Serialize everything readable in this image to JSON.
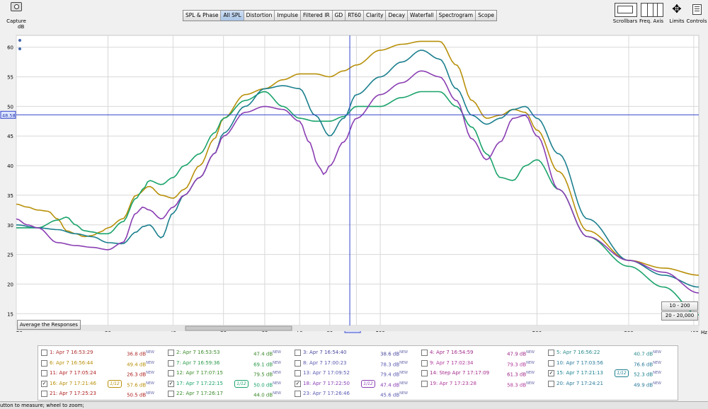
{
  "toolbar": {
    "capture_label": "Capture",
    "tabs": [
      "SPL & Phase",
      "All SPL",
      "Distortion",
      "Impulse",
      "Filtered IR",
      "GD",
      "RT60",
      "Clarity",
      "Decay",
      "Waterfall",
      "Spectrogram",
      "Scope"
    ],
    "active_tab": 1,
    "right_buttons": [
      "Scrollbars",
      "Freq. Axis",
      "Limits",
      "Controls"
    ]
  },
  "graph": {
    "y_unit": "dB",
    "x_unit": "Hz",
    "cursor_db_label": "48.58",
    "cursor_hz_label": "87.4",
    "average_button": "Average the Responses",
    "range_buttons": [
      "10 - 200",
      "20 - 20,000"
    ]
  },
  "chart_data": {
    "type": "line",
    "xlabel": "Hz",
    "ylabel": "dB",
    "x_scale": "log",
    "xlim": [
      20,
      409
    ],
    "ylim": [
      13,
      62
    ],
    "x_ticks": [
      20,
      30,
      40,
      50,
      60,
      70,
      80,
      90,
      100,
      200,
      300,
      409
    ],
    "x_tick_labels": [
      "20",
      "30",
      "40",
      "50",
      "60",
      "70",
      "80",
      "",
      "100",
      "200",
      "300",
      "409"
    ],
    "y_ticks": [
      15,
      20,
      25,
      30,
      35,
      40,
      45,
      50,
      55,
      60
    ],
    "cursor": {
      "x": 87.4,
      "y": 48.58
    },
    "grid": true,
    "series": [
      {
        "name": "6: Apr 7 16:56:44",
        "color": "#b8900a",
        "x": [
          20,
          21,
          22,
          23,
          24,
          25,
          26,
          27,
          28,
          29,
          30,
          32,
          34,
          36,
          38,
          40,
          42,
          45,
          48,
          50,
          55,
          60,
          65,
          70,
          75,
          80,
          85,
          90,
          100,
          110,
          120,
          130,
          140,
          150,
          160,
          170,
          180,
          190,
          200,
          220,
          250,
          300,
          350,
          409
        ],
        "y": [
          33.5,
          33,
          32.5,
          32.3,
          31,
          29,
          28.5,
          28,
          28.2,
          28.8,
          29.5,
          31,
          35,
          36.5,
          35,
          34.5,
          36,
          40,
          44.5,
          48,
          52,
          53,
          54.5,
          55.5,
          55.5,
          55,
          56,
          57,
          59.5,
          60.5,
          61,
          61,
          57,
          51,
          48,
          48.5,
          49.5,
          49,
          46,
          39,
          29,
          24,
          22.7,
          21.5
        ]
      },
      {
        "name": "16: Apr 7 17:21:46",
        "color": "#1aa36b",
        "x": [
          20,
          22,
          24,
          25,
          26,
          27,
          28,
          29,
          30,
          32,
          34,
          35,
          36,
          38,
          40,
          42,
          45,
          48,
          50,
          55,
          60,
          65,
          70,
          75,
          80,
          85,
          90,
          100,
          110,
          120,
          130,
          140,
          150,
          160,
          170,
          180,
          190,
          200,
          220,
          250,
          300,
          350,
          409
        ],
        "y": [
          29.5,
          29.5,
          30.8,
          31.3,
          30,
          29,
          28.8,
          28.5,
          28.5,
          30.5,
          34.5,
          36,
          37.5,
          36.8,
          38,
          40,
          42,
          45.5,
          48,
          51,
          52.5,
          50,
          48,
          47.5,
          47.5,
          48.3,
          50,
          50,
          51.5,
          52.5,
          52.5,
          50,
          46.5,
          42,
          38,
          37.5,
          40,
          41,
          36,
          28,
          23,
          19.5,
          14.8
        ]
      },
      {
        "name": "15: Apr 7 17:21:13",
        "color": "#1b7f8e",
        "x": [
          20,
          22,
          24,
          26,
          28,
          30,
          32,
          34,
          35,
          36,
          38,
          40,
          42,
          45,
          48,
          50,
          55,
          60,
          65,
          70,
          75,
          80,
          85,
          90,
          100,
          110,
          120,
          130,
          140,
          150,
          160,
          170,
          180,
          190,
          200,
          220,
          250,
          300,
          350,
          409
        ],
        "y": [
          30,
          29.5,
          29.2,
          28.5,
          28,
          27,
          26.8,
          28.8,
          29.7,
          30,
          27.8,
          32,
          35,
          38,
          42,
          45.5,
          50,
          53,
          53.5,
          53,
          48.5,
          45,
          48,
          52,
          55,
          57.5,
          59.5,
          58,
          53,
          48.5,
          47,
          48,
          49.5,
          50,
          48,
          42,
          31,
          24,
          21.5,
          19.5
        ]
      },
      {
        "name": "18: Apr 7 17:22:50",
        "color": "#8a3eb3",
        "x": [
          20,
          21,
          22,
          24,
          26,
          28,
          30,
          32,
          34,
          35,
          36,
          38,
          40,
          42,
          45,
          48,
          50,
          55,
          60,
          65,
          70,
          73,
          76,
          78,
          80,
          85,
          90,
          100,
          110,
          120,
          130,
          140,
          150,
          160,
          170,
          180,
          190,
          200,
          220,
          250,
          300,
          350,
          409
        ],
        "y": [
          31,
          30,
          29.5,
          27,
          26.5,
          26.2,
          25.8,
          27,
          32,
          33,
          32.5,
          31,
          33,
          35,
          38,
          42,
          45,
          49,
          50,
          49.5,
          47.5,
          44,
          40,
          38.5,
          40,
          44,
          48,
          52,
          54,
          56,
          55,
          51,
          44.5,
          41,
          44,
          48,
          48.5,
          45,
          36,
          28,
          24,
          22,
          18.5
        ]
      }
    ],
    "legend": [
      {
        "name": "1: Apr 7 16:53:29",
        "value": "36.8 dB",
        "color": "#b03030",
        "checked": false
      },
      {
        "name": "2: Apr 7 16:53:53",
        "value": "47.4 dB",
        "color": "#3a8a2a",
        "checked": false
      },
      {
        "name": "3: Apr 7 16:54:40",
        "value": "38.6 dB",
        "color": "#4a4aa0",
        "checked": false
      },
      {
        "name": "4: Apr 7 16:54:59",
        "value": "47.9 dB",
        "color": "#a02a8a",
        "checked": false
      },
      {
        "name": "5: Apr 7 16:56:22",
        "value": "40.7 dB",
        "color": "#2a8a8a",
        "checked": false
      },
      {
        "name": "6: Apr 7 16:56:44",
        "value": "49.4 dB",
        "color": "#b8900a",
        "checked": false
      },
      {
        "name": "7: Apr 7 16:59:36",
        "value": "69.1 dB",
        "color": "#2a9a4a",
        "checked": false
      },
      {
        "name": "8: Apr 7 17:00:23",
        "value": "78.3 dB",
        "color": "#5a5ab0",
        "checked": false
      },
      {
        "name": "9: Apr 7 17:02:34",
        "value": "79.3 dB",
        "color": "#b03a9a",
        "checked": false
      },
      {
        "name": "10: Apr 7 17:03:56",
        "value": "76.6 dB",
        "color": "#2a7a9a",
        "checked": false
      },
      {
        "name": "11: Apr 7 17:05:24",
        "value": "26.3 dB",
        "color": "#b02020",
        "checked": false
      },
      {
        "name": "12: Apr 7 17:07:15",
        "value": "79.5 dB",
        "color": "#3a8a2a",
        "checked": false
      },
      {
        "name": "13: Apr 7 17:09:52",
        "value": "79.4 dB",
        "color": "#5a5ab0",
        "checked": false
      },
      {
        "name": "14: Step Apr 7 17:17:09",
        "value": "61.3 dB",
        "color": "#a02a8a",
        "checked": false
      },
      {
        "name": "15: Apr 7 17:21:13",
        "value": "52.3 dB",
        "color": "#1b7f8e",
        "checked": true
      },
      {
        "name": "16: Apr 7 17:21:46",
        "value": "57.6 dB",
        "color": "#b8900a",
        "checked": true
      },
      {
        "name": "17: Apr 7 17:22:15",
        "value": "50.0 dB",
        "color": "#1aa36b",
        "checked": true
      },
      {
        "name": "18: Apr 7 17:22:50",
        "value": "47.4 dB",
        "color": "#8a3eb3",
        "checked": true
      },
      {
        "name": "19: Apr 7 17:23:28",
        "value": "58.3 dB",
        "color": "#b03a9a",
        "checked": false
      },
      {
        "name": "20: Apr 7 17:24:21",
        "value": "49.9 dB",
        "color": "#2a7a9a",
        "checked": false
      },
      {
        "name": "21: Apr 7 17:25:23",
        "value": "50.5 dB",
        "color": "#b02020",
        "checked": false
      },
      {
        "name": "22: Apr 7 17:26:17",
        "value": "44.0 dB",
        "color": "#3a8a2a",
        "checked": false
      },
      {
        "name": "23: Apr 7 17:26:46",
        "value": "45.6 dB",
        "color": "#5a5ab0",
        "checked": false
      }
    ],
    "smoothing_label": "1/12",
    "new_badge": "NEW"
  },
  "status": {
    "text": "utton to measure; wheel to zoom;"
  }
}
